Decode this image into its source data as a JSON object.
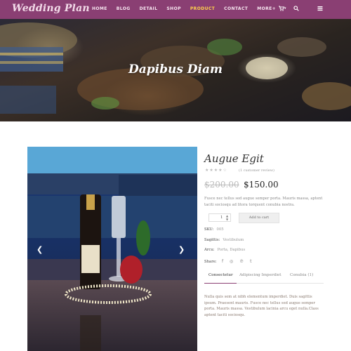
{
  "header": {
    "logo": "Wedding Plan",
    "menu": [
      "HOME",
      "BLOG",
      "DETAIL",
      "SHOP",
      "PRODUCT",
      "CONTACT",
      "MORE+"
    ],
    "active_menu": "PRODUCT",
    "icons": [
      "cart-icon",
      "search-icon",
      "menu-icon"
    ],
    "cart_glyph": "▾",
    "colors": {
      "nav": "#8a3f73",
      "active": "#ffd24a"
    }
  },
  "hero": {
    "title": "Dapibus Diam"
  },
  "product": {
    "name": "Augue Egit",
    "rating_stars": "★★★★☆",
    "rating": 4,
    "reviews": "(1 customer review)",
    "old_price": "$200.00",
    "price": "$150.00",
    "description": "Fusce nec tellus sed augue semper porta. Mauris massa, aptent taciti sociosqu ad litora torquent conubia nostra.",
    "quantity": "1",
    "add_to_cart": "Add to cart",
    "sku_label": "SKU:",
    "sku_value": "005",
    "sagittis_label": "Sagittis:",
    "sagittis_value": "Vestibulum",
    "arcu_label": "Arcu:",
    "arcu_value": "Porta, Dapibus",
    "share_label": "Share:",
    "share_icons": [
      "facebook-icon",
      "instagram-icon",
      "pinterest-icon",
      "tumblr-icon"
    ],
    "tabs": [
      "Consectetur",
      "Adipiscing Imperdiet",
      "Conubia (1)"
    ],
    "active_tab": "Consectetur",
    "tab_content": "Nulla quis sem at nibh elementum imperdiet. Duis sagittis ipsum. Praesent mauris. Fusce nec tellus sed augue semper porta. Mauris massa. Vestibulum lacinia arcu eget nulla.Class aptent taciti sociosqu."
  },
  "gallery": {
    "prev": "❮",
    "next": "❯"
  }
}
